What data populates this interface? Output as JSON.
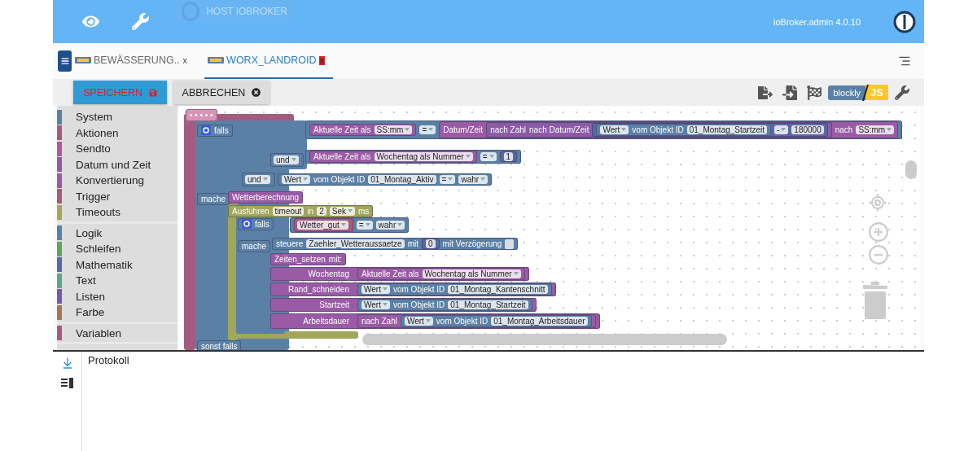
{
  "header": {
    "host_button": "HOST IOBROKER",
    "version": "ioBroker.admin 4.0.10"
  },
  "tabs": [
    {
      "label": "BEWÄSSERUNG..",
      "close": "x",
      "selected": false
    },
    {
      "label": "WORX_LANDROID",
      "close": "x",
      "selected": true
    }
  ],
  "toolbar": {
    "save": "SPEICHERN",
    "cancel": "ABBRECHEN",
    "mode_blockly": "blockly",
    "mode_js": "JS"
  },
  "toolbox": {
    "groups": [
      [
        {
          "label": "System",
          "color": "#5b80a5"
        },
        {
          "label": "Aktionen",
          "color": "#a55b80"
        },
        {
          "label": "Sendto",
          "color": "#b0579f"
        },
        {
          "label": "Datum und Zeit",
          "color": "#8e5ba5"
        },
        {
          "label": "Konvertierung",
          "color": "#9a5ba5"
        },
        {
          "label": "Trigger",
          "color": "#a55b7a"
        },
        {
          "label": "Timeouts",
          "color": "#a5a55b"
        }
      ],
      [
        {
          "label": "Logik",
          "color": "#5b80a5"
        },
        {
          "label": "Schleifen",
          "color": "#5ba55b"
        },
        {
          "label": "Mathematik",
          "color": "#5b67a5"
        },
        {
          "label": "Text",
          "color": "#5ba58c"
        },
        {
          "label": "Listen",
          "color": "#745ba5"
        },
        {
          "label": "Farbe",
          "color": "#a5745b"
        }
      ],
      [
        {
          "label": "Variablen",
          "color": "#a55b80"
        }
      ]
    ]
  },
  "canvas": {
    "blocks": [
      {
        "color": "#d894b4",
        "parts": [
          {
            "kind": "label",
            "text": "• • • • •"
          }
        ]
      },
      {
        "color": "#5b80a5",
        "parts": [
          {
            "kind": "gear"
          },
          {
            "kind": "label",
            "text": "falls"
          }
        ]
      },
      {
        "color": "#5b80a5",
        "parts": [
          {
            "kind": "block",
            "color": "#9a5ba5",
            "parts": [
              {
                "kind": "label",
                "text": "Aktuelle Zeit als"
              },
              {
                "kind": "dropdown",
                "text": "SS:mm"
              }
            ]
          },
          {
            "kind": "dropdown",
            "text": "="
          },
          {
            "kind": "block",
            "color": "#9a5ba5",
            "parts": [
              {
                "kind": "label",
                "text": "Datum/Zeit"
              },
              {
                "kind": "block",
                "color": "#8b5ba5",
                "parts": [
                  {
                    "kind": "label",
                    "text": "nach Zahl"
                  },
                  {
                    "kind": "label",
                    "text": "nach Datum/Zeit"
                  },
                  {
                    "kind": "block",
                    "color": "#5b67a5",
                    "parts": [
                      {
                        "kind": "block",
                        "color": "#5b80a5",
                        "parts": [
                          {
                            "kind": "dropdown",
                            "text": "Wert"
                          },
                          {
                            "kind": "label",
                            "text": "vom Objekt ID"
                          },
                          {
                            "kind": "field",
                            "text": "01_Montag_Startzeit"
                          }
                        ]
                      },
                      {
                        "kind": "dropdown",
                        "text": "-"
                      },
                      {
                        "kind": "field",
                        "text": "180000"
                      }
                    ]
                  }
                ]
              },
              {
                "kind": "label",
                "text": "nach"
              },
              {
                "kind": "dropdown",
                "text": "SS:mm"
              }
            ]
          }
        ]
      },
      {
        "color": "#5b80a5",
        "parts": [
          {
            "kind": "dropdown",
            "text": "und"
          }
        ]
      },
      {
        "color": "#5b80a5",
        "parts": [
          {
            "kind": "block",
            "color": "#9a5ba5",
            "parts": [
              {
                "kind": "label",
                "text": "Aktuelle Zeit als"
              },
              {
                "kind": "dropdown",
                "text": "Wochentag als Nummer"
              }
            ]
          },
          {
            "kind": "dropdown",
            "text": "="
          },
          {
            "kind": "block",
            "color": "#5b67a5",
            "parts": [
              {
                "kind": "field",
                "text": "1"
              }
            ]
          }
        ]
      },
      {
        "color": "#5b80a5",
        "parts": [
          {
            "kind": "dropdown",
            "text": "und"
          }
        ]
      },
      {
        "color": "#5b80a5",
        "parts": [
          {
            "kind": "dropdown",
            "text": "Wert"
          },
          {
            "kind": "label",
            "text": "vom Objekt ID"
          },
          {
            "kind": "field",
            "text": "01_Montag_Aktiv"
          },
          {
            "kind": "dropdown",
            "text": "="
          },
          {
            "kind": "dropdown",
            "text": "wahr"
          }
        ]
      },
      {
        "color": "#5b80a5",
        "parts": [
          {
            "kind": "label",
            "text": "mache"
          }
        ]
      },
      {
        "color": "#995ba5",
        "parts": [
          {
            "kind": "label",
            "text": "Wetterberechnung"
          }
        ]
      },
      {
        "color": "#a0a65a",
        "parts": [
          {
            "kind": "label",
            "text": "Ausführen"
          },
          {
            "kind": "field",
            "text": "timeout"
          },
          {
            "kind": "label",
            "text": "in"
          },
          {
            "kind": "field",
            "text": "2"
          },
          {
            "kind": "dropdown",
            "text": "Sek"
          },
          {
            "kind": "label",
            "text": "ms"
          }
        ]
      },
      {
        "color": "#5b80a5",
        "parts": [
          {
            "kind": "gear"
          },
          {
            "kind": "label",
            "text": "falls"
          }
        ]
      },
      {
        "color": "#5b80a5",
        "parts": [
          {
            "kind": "block",
            "color": "#a55b80",
            "parts": [
              {
                "kind": "dropdown",
                "text": "Wetter_gut"
              }
            ]
          },
          {
            "kind": "dropdown",
            "text": "="
          },
          {
            "kind": "dropdown",
            "text": "wahr"
          }
        ]
      },
      {
        "color": "#5b80a5",
        "parts": [
          {
            "kind": "label",
            "text": "mache"
          }
        ]
      },
      {
        "color": "#5b80a5",
        "parts": [
          {
            "kind": "label",
            "text": "steuere"
          },
          {
            "kind": "field",
            "text": "Zaehler_Wetteraussaetze"
          },
          {
            "kind": "label",
            "text": "mit"
          },
          {
            "kind": "block",
            "color": "#5b67a5",
            "parts": [
              {
                "kind": "field",
                "text": "0"
              }
            ]
          },
          {
            "kind": "label",
            "text": "mit Verzögerung"
          },
          {
            "kind": "checkbox",
            "checked": false
          }
        ]
      },
      {
        "color": "#995ba5",
        "parts": [
          {
            "kind": "label",
            "text": "Zeiten_setzen"
          },
          {
            "kind": "label",
            "text": "mit:"
          }
        ]
      },
      {
        "color": "#995ba5",
        "parts": [
          {
            "kind": "param",
            "text": "Wochentag"
          },
          {
            "kind": "block",
            "color": "#9a5ba5",
            "parts": [
              {
                "kind": "label",
                "text": "Aktuelle Zeit als"
              },
              {
                "kind": "dropdown",
                "text": "Wochentag als Nummer"
              }
            ]
          }
        ]
      },
      {
        "color": "#995ba5",
        "parts": [
          {
            "kind": "param",
            "text": "Rand_schneiden"
          },
          {
            "kind": "block",
            "color": "#5b80a5",
            "parts": [
              {
                "kind": "dropdown",
                "text": "Wert"
              },
              {
                "kind": "label",
                "text": "vom Objekt ID"
              },
              {
                "kind": "field",
                "text": "01_Montag_Kantenschnitt"
              }
            ]
          }
        ]
      },
      {
        "color": "#995ba5",
        "parts": [
          {
            "kind": "param",
            "text": "Startzeit"
          },
          {
            "kind": "block",
            "color": "#5b80a5",
            "parts": [
              {
                "kind": "dropdown",
                "text": "Wert"
              },
              {
                "kind": "label",
                "text": "vom Objekt ID"
              },
              {
                "kind": "field",
                "text": "01_Montag_Startzeit"
              }
            ]
          }
        ]
      },
      {
        "color": "#995ba5",
        "parts": [
          {
            "kind": "param",
            "text": "Arbeitsdauer"
          },
          {
            "kind": "block",
            "color": "#995ba5",
            "parts": [
              {
                "kind": "label",
                "text": "nach Zahl"
              },
              {
                "kind": "block",
                "color": "#5b80a5",
                "parts": [
                  {
                    "kind": "dropdown",
                    "text": "Wert"
                  },
                  {
                    "kind": "label",
                    "text": "vom Objekt ID"
                  },
                  {
                    "kind": "field",
                    "text": "01_Montag_Arbeitsdauer"
                  }
                ]
              }
            ]
          }
        ]
      },
      {
        "color": "#5b80a5",
        "parts": [
          {
            "kind": "label",
            "text": "sonst falls"
          }
        ]
      }
    ]
  },
  "log": {
    "title": "Protokoll"
  }
}
